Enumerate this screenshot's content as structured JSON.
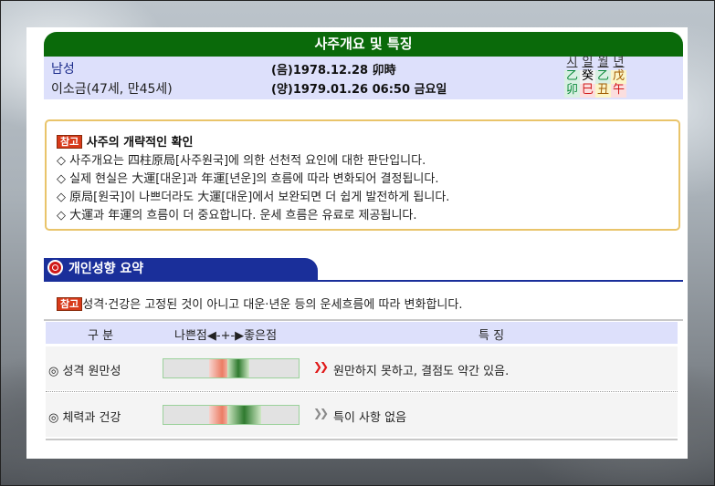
{
  "header": {
    "title": "사주개요 및 특징"
  },
  "person": {
    "gender": "남성",
    "name_age": "이소금(47세, 만45세)",
    "lunar": "(음)1978.12.28 卯時",
    "solar": "(양)1979.01.26 06:50 금요일"
  },
  "pillars": {
    "headers": [
      "시",
      "일",
      "월",
      "년"
    ],
    "stems": [
      "乙",
      "癸",
      "乙",
      "戊"
    ],
    "branches": [
      "卯",
      "巳",
      "丑",
      "午"
    ]
  },
  "note": {
    "badge": "참고",
    "heading": "사주의 개략적인 확인",
    "lines": [
      "◇ 사주개요는 四柱原局[사주원국]에 의한 선천적 요인에 대한 판단입니다.",
      "◇ 실제 현실은 大運[대운]과 年運[년운]의 흐름에 따라 변화되어 결정됩니다.",
      "◇ 原局[원국]이 나쁘더라도 大運[대운]에서 보완되면 더 쉽게 발전하게 됩니다.",
      "◇ 大運과 年運의 흐름이 더 중요합니다. 운세 흐름은 유료로 제공됩니다."
    ]
  },
  "section": {
    "title": "개인성향 요약",
    "notice_badge": "참고",
    "notice_text": "성격·건강은 고정된 것이 아니고 대운·년운 등의 운세흐름에 따라 변화합니다."
  },
  "table": {
    "col_category": "구 분",
    "col_scale": "나쁜점◀-+-▶좋은점",
    "col_feature": "특 징",
    "rows": [
      {
        "label": "◎ 성격 원만성",
        "description": "원만하지 못하고, 결점도 약간 있음.",
        "score": 0.58,
        "arrow_color": "#e01818"
      },
      {
        "label": "◎ 체력과 건강",
        "description": "특이 사항 없음",
        "score": 0.67,
        "arrow_color": "#8a8a8a"
      }
    ]
  }
}
